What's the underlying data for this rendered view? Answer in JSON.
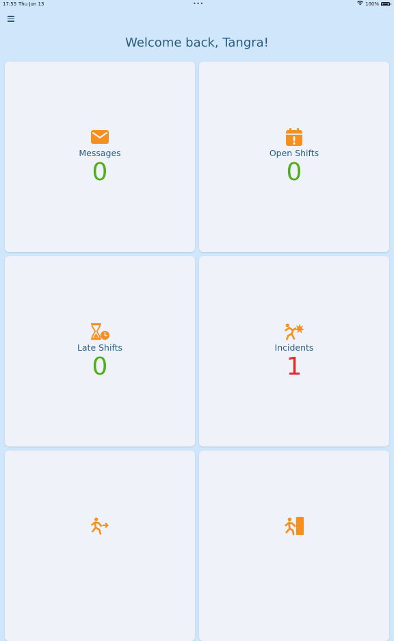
{
  "status_bar": {
    "time": "17:55",
    "date": "Thu Jun 13",
    "battery": "100%",
    "dots": "•••"
  },
  "header": {
    "welcome": "Welcome back, Tangra!"
  },
  "colors": {
    "accent_orange": "#f5901e",
    "count_zero": "#4fae1a",
    "count_nonzero": "#d7302d",
    "text_primary": "#2b5c7d",
    "background": "#cfe6fb",
    "card": "#eff3f9"
  },
  "cards": [
    {
      "label": "Messages",
      "count": "0",
      "icon": "envelope-icon"
    },
    {
      "label": "Open Shifts",
      "count": "0",
      "icon": "calendar-alert-icon"
    },
    {
      "label": "Late Shifts",
      "count": "0",
      "icon": "hourglass-clock-icon"
    },
    {
      "label": "Incidents",
      "count": "1",
      "icon": "falling-person-icon"
    },
    {
      "label": "",
      "count": "",
      "icon": "person-running-icon"
    },
    {
      "label": "",
      "count": "",
      "icon": "person-exit-door-icon"
    }
  ]
}
